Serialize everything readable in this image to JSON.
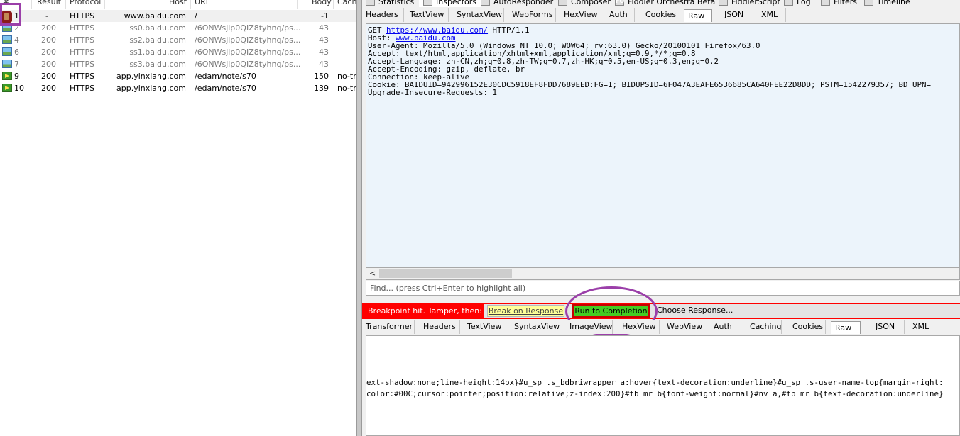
{
  "sessions": {
    "columns": [
      "#",
      "Result",
      "Protocol",
      "Host",
      "URL",
      "Body",
      "Cachi"
    ],
    "rows": [
      {
        "id": "1",
        "result": "-",
        "protocol": "HTTPS",
        "host": "www.baidu.com",
        "url": "/",
        "body": "-1",
        "caching": "",
        "icon": "breakpoint-icon",
        "state": "selected"
      },
      {
        "id": "2",
        "result": "200",
        "protocol": "HTTPS",
        "host": "ss0.baidu.com",
        "url": "/6ONWsjip0QIZ8tyhnq/ps...",
        "body": "43",
        "caching": "",
        "icon": "image-icon",
        "state": "gray"
      },
      {
        "id": "4",
        "result": "200",
        "protocol": "HTTPS",
        "host": "ss2.baidu.com",
        "url": "/6ONWsjip0QIZ8tyhnq/ps...",
        "body": "43",
        "caching": "",
        "icon": "image-icon",
        "state": "gray"
      },
      {
        "id": "6",
        "result": "200",
        "protocol": "HTTPS",
        "host": "ss1.baidu.com",
        "url": "/6ONWsjip0QIZ8tyhnq/ps...",
        "body": "43",
        "caching": "",
        "icon": "image-icon",
        "state": "gray"
      },
      {
        "id": "7",
        "result": "200",
        "protocol": "HTTPS",
        "host": "ss3.baidu.com",
        "url": "/6ONWsjip0QIZ8tyhnq/ps...",
        "body": "43",
        "caching": "",
        "icon": "image-icon",
        "state": "gray"
      },
      {
        "id": "9",
        "result": "200",
        "protocol": "HTTPS",
        "host": "app.yinxiang.com",
        "url": "/edam/note/s70",
        "body": "150",
        "caching": "no-tra",
        "icon": "arrow-icon",
        "state": "normal"
      },
      {
        "id": "10",
        "result": "200",
        "protocol": "HTTPS",
        "host": "app.yinxiang.com",
        "url": "/edam/note/s70",
        "body": "139",
        "caching": "no-tra",
        "icon": "arrow-icon",
        "state": "normal"
      }
    ]
  },
  "main_tabs": [
    {
      "label": "Statistics",
      "icon": "statistics-icon"
    },
    {
      "label": "Inspectors",
      "icon": "inspectors-icon"
    },
    {
      "label": "AutoResponder",
      "icon": "autoresponder-icon"
    },
    {
      "label": "Composer",
      "icon": "composer-icon"
    },
    {
      "label": "Fiddler Orchestra Beta",
      "icon": "orchestra-icon",
      "badge": "FO"
    },
    {
      "label": "FiddlerScript",
      "icon": "script-icon"
    },
    {
      "label": "Log",
      "icon": "log-icon"
    },
    {
      "label": "Filters",
      "icon": "filters-icon"
    },
    {
      "label": "Timeline",
      "icon": "timeline-icon"
    }
  ],
  "request": {
    "tabs": [
      "Headers",
      "TextView",
      "SyntaxView",
      "WebForms",
      "HexView",
      "Auth",
      "Cookies",
      "Raw",
      "JSON",
      "XML"
    ],
    "active_tab": "Raw",
    "raw": {
      "line1_method": "GET ",
      "line1_url": "https://www.baidu.com/",
      "line1_version": " HTTP/1.1",
      "host_label": "Host: ",
      "host_value": "www.baidu.com",
      "rest": "User-Agent: Mozilla/5.0 (Windows NT 10.0; WOW64; rv:63.0) Gecko/20100101 Firefox/63.0\nAccept: text/html,application/xhtml+xml,application/xml;q=0.9,*/*;q=0.8\nAccept-Language: zh-CN,zh;q=0.8,zh-TW;q=0.7,zh-HK;q=0.5,en-US;q=0.3,en;q=0.2\nAccept-Encoding: gzip, deflate, br\nConnection: keep-alive\nCookie: BAIDUID=942996152E30CDC5918EF8FDD7689EED:FG=1; BIDUPSID=6F047A3EAFE6536685CA640FEE22D8DD; PSTM=1542279357; BD_UPN=\nUpgrade-Insecure-Requests: 1"
    },
    "find_placeholder": "Find... (press Ctrl+Enter to highlight all)"
  },
  "breakpoint": {
    "label": "Breakpoint hit. Tamper, then:",
    "break_on_response": "Break on Response",
    "run_to_completion": "Run to Completion",
    "choose_response": "Choose Response..."
  },
  "response": {
    "tabs": [
      "Transformer",
      "Headers",
      "TextView",
      "SyntaxView",
      "ImageView",
      "HexView",
      "WebView",
      "Auth",
      "Caching",
      "Cookies",
      "Raw",
      "JSON",
      "XML"
    ],
    "active_tab": "Raw",
    "raw_lines": [
      "ext-shadow:none;line-height:14px}#u_sp .s_bdbriwrapper a:hover{text-decoration:underline}#u_sp .s-user-name-top{margin-right:",
      "color:#00C;cursor:pointer;position:relative;z-index:200}#tb_mr b{font-weight:normal}#nv a,#tb_mr b{text-decoration:underline}"
    ]
  },
  "colors": {
    "breakpoint_red": "#ff0000",
    "run_green": "#44cc22",
    "break_yellow": "#ffff99",
    "annotation_purple": "#9b3fa9",
    "request_bg": "#ecf4fb"
  }
}
